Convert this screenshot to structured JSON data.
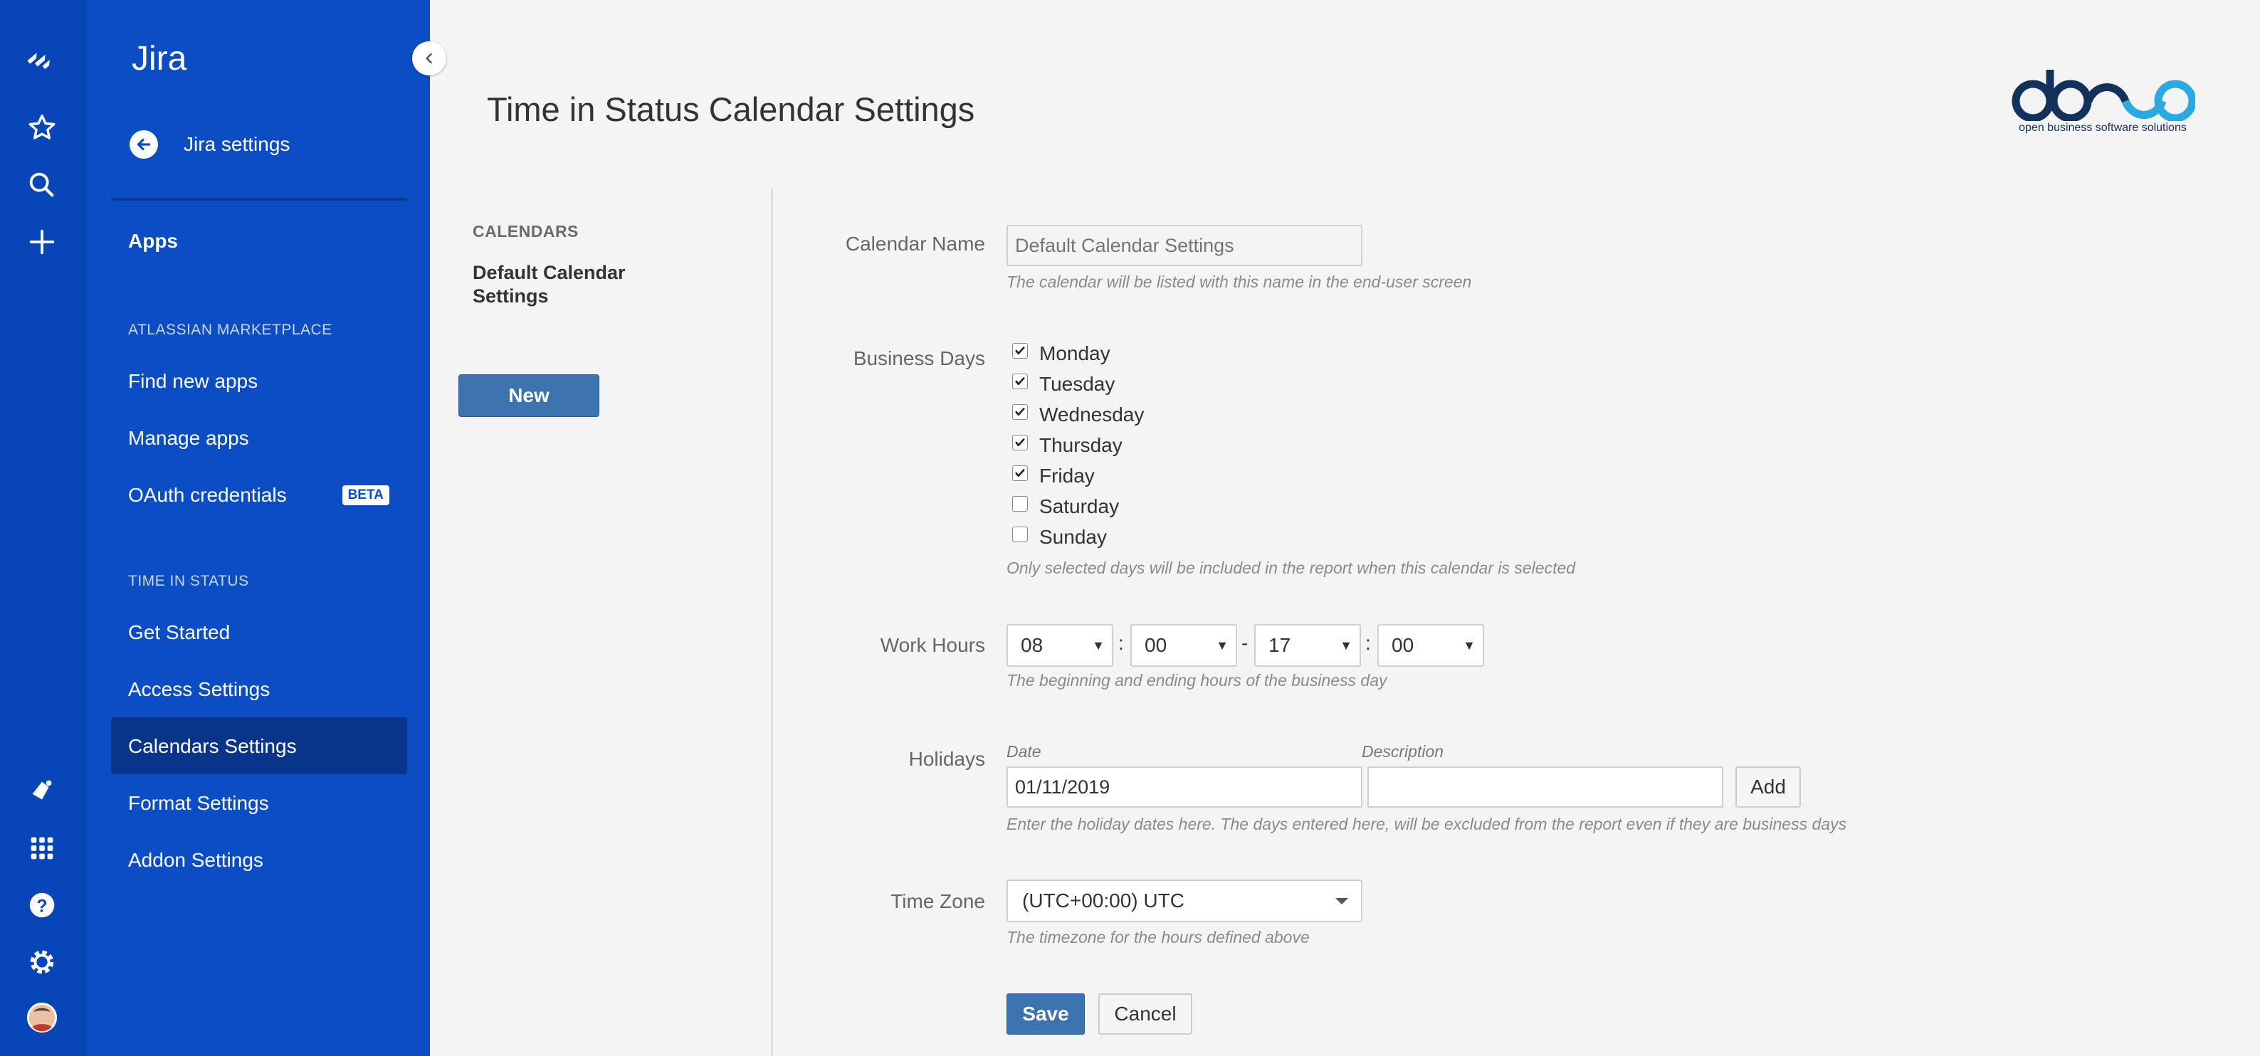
{
  "colors": {
    "nav_dark": "#0745b9",
    "sidebar": "#0b4dc4",
    "active_item": "#08348a",
    "primary_button": "#3b73af",
    "page_bg": "#f4f4f4"
  },
  "global_nav": {
    "icons": [
      "jira-logo-icon",
      "star-icon",
      "search-icon",
      "plus-icon",
      "notification-icon",
      "app-switcher-icon",
      "help-icon",
      "gear-icon",
      "avatar"
    ]
  },
  "sidebar": {
    "title": "Jira",
    "back_label": "Jira settings",
    "apps_label": "Apps",
    "marketplace_heading": "ATLASSIAN MARKETPLACE",
    "find_apps": "Find new apps",
    "manage_apps": "Manage apps",
    "oauth": "OAuth credentials",
    "beta_badge": "BETA",
    "tis_heading": "TIME IN STATUS",
    "get_started": "Get Started",
    "access_settings": "Access Settings",
    "calendars_settings": "Calendars Settings",
    "format_settings": "Format Settings",
    "addon_settings": "Addon Settings"
  },
  "page": {
    "title": "Time in Status Calendar Settings",
    "logo_caption": "open business software solutions",
    "calendars_heading": "CALENDARS",
    "calendar_item": "Default Calendar Settings",
    "new_button": "New"
  },
  "form": {
    "name_label": "Calendar Name",
    "name_placeholder": "Default Calendar Settings",
    "name_hint": "The calendar will be listed with this name in the end-user screen",
    "days_label": "Business Days",
    "days": [
      {
        "name": "Monday",
        "checked": true
      },
      {
        "name": "Tuesday",
        "checked": true
      },
      {
        "name": "Wednesday",
        "checked": true
      },
      {
        "name": "Thursday",
        "checked": true
      },
      {
        "name": "Friday",
        "checked": true
      },
      {
        "name": "Saturday",
        "checked": false
      },
      {
        "name": "Sunday",
        "checked": false
      }
    ],
    "days_hint": "Only selected days will be included in the report when this calendar is selected",
    "hours_label": "Work Hours",
    "start_hour": "08",
    "start_minute": "00",
    "end_hour": "17",
    "end_minute": "00",
    "colon": ":",
    "dash": "-",
    "hours_hint": "The beginning and ending hours of the business day",
    "holidays_label": "Holidays",
    "date_label": "Date",
    "description_label": "Description",
    "date_value": "01/11/2019",
    "description_value": "",
    "add_button": "Add",
    "holidays_hint": "Enter the holiday dates here. The days entered here, will be excluded from the report even if they are business days",
    "timezone_label": "Time Zone",
    "timezone_value": "(UTC+00:00) UTC",
    "timezone_hint": "The timezone for the hours defined above",
    "save_button": "Save",
    "cancel_button": "Cancel"
  }
}
